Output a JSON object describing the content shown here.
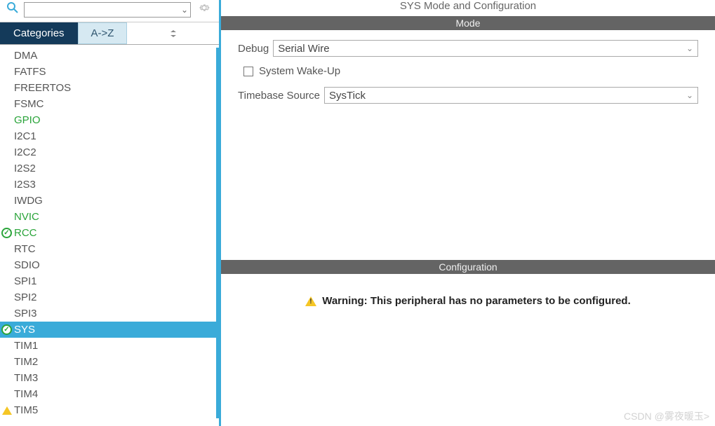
{
  "title": "SYS Mode and Configuration",
  "tabs": {
    "categories": "Categories",
    "alpha": "A->Z"
  },
  "peripherals": [
    {
      "label": "DMA",
      "state": "normal"
    },
    {
      "label": "FATFS",
      "state": "normal"
    },
    {
      "label": "FREERTOS",
      "state": "normal"
    },
    {
      "label": "FSMC",
      "state": "normal"
    },
    {
      "label": "GPIO",
      "state": "green"
    },
    {
      "label": "I2C1",
      "state": "normal"
    },
    {
      "label": "I2C2",
      "state": "normal"
    },
    {
      "label": "I2S2",
      "state": "normal"
    },
    {
      "label": "I2S3",
      "state": "normal"
    },
    {
      "label": "IWDG",
      "state": "normal"
    },
    {
      "label": "NVIC",
      "state": "green"
    },
    {
      "label": "RCC",
      "state": "green",
      "check": true
    },
    {
      "label": "RTC",
      "state": "normal"
    },
    {
      "label": "SDIO",
      "state": "normal"
    },
    {
      "label": "SPI1",
      "state": "normal"
    },
    {
      "label": "SPI2",
      "state": "normal"
    },
    {
      "label": "SPI3",
      "state": "normal"
    },
    {
      "label": "SYS",
      "state": "selected",
      "check": true
    },
    {
      "label": "TIM1",
      "state": "normal"
    },
    {
      "label": "TIM2",
      "state": "normal"
    },
    {
      "label": "TIM3",
      "state": "normal"
    },
    {
      "label": "TIM4",
      "state": "normal"
    },
    {
      "label": "TIM5",
      "state": "normal",
      "warn": true
    }
  ],
  "sections": {
    "mode": "Mode",
    "configuration": "Configuration"
  },
  "mode_form": {
    "debug_label": "Debug",
    "debug_value": "Serial Wire",
    "wake_label": "System Wake-Up",
    "timebase_label": "Timebase Source",
    "timebase_value": "SysTick"
  },
  "config_warning": "Warning: This peripheral has no parameters to be configured.",
  "watermark": "CSDN @雾夜暖玉>",
  "icons": {
    "search": "search-icon",
    "gear": "gear-icon",
    "sort_handle": "sort-handle-icon"
  }
}
